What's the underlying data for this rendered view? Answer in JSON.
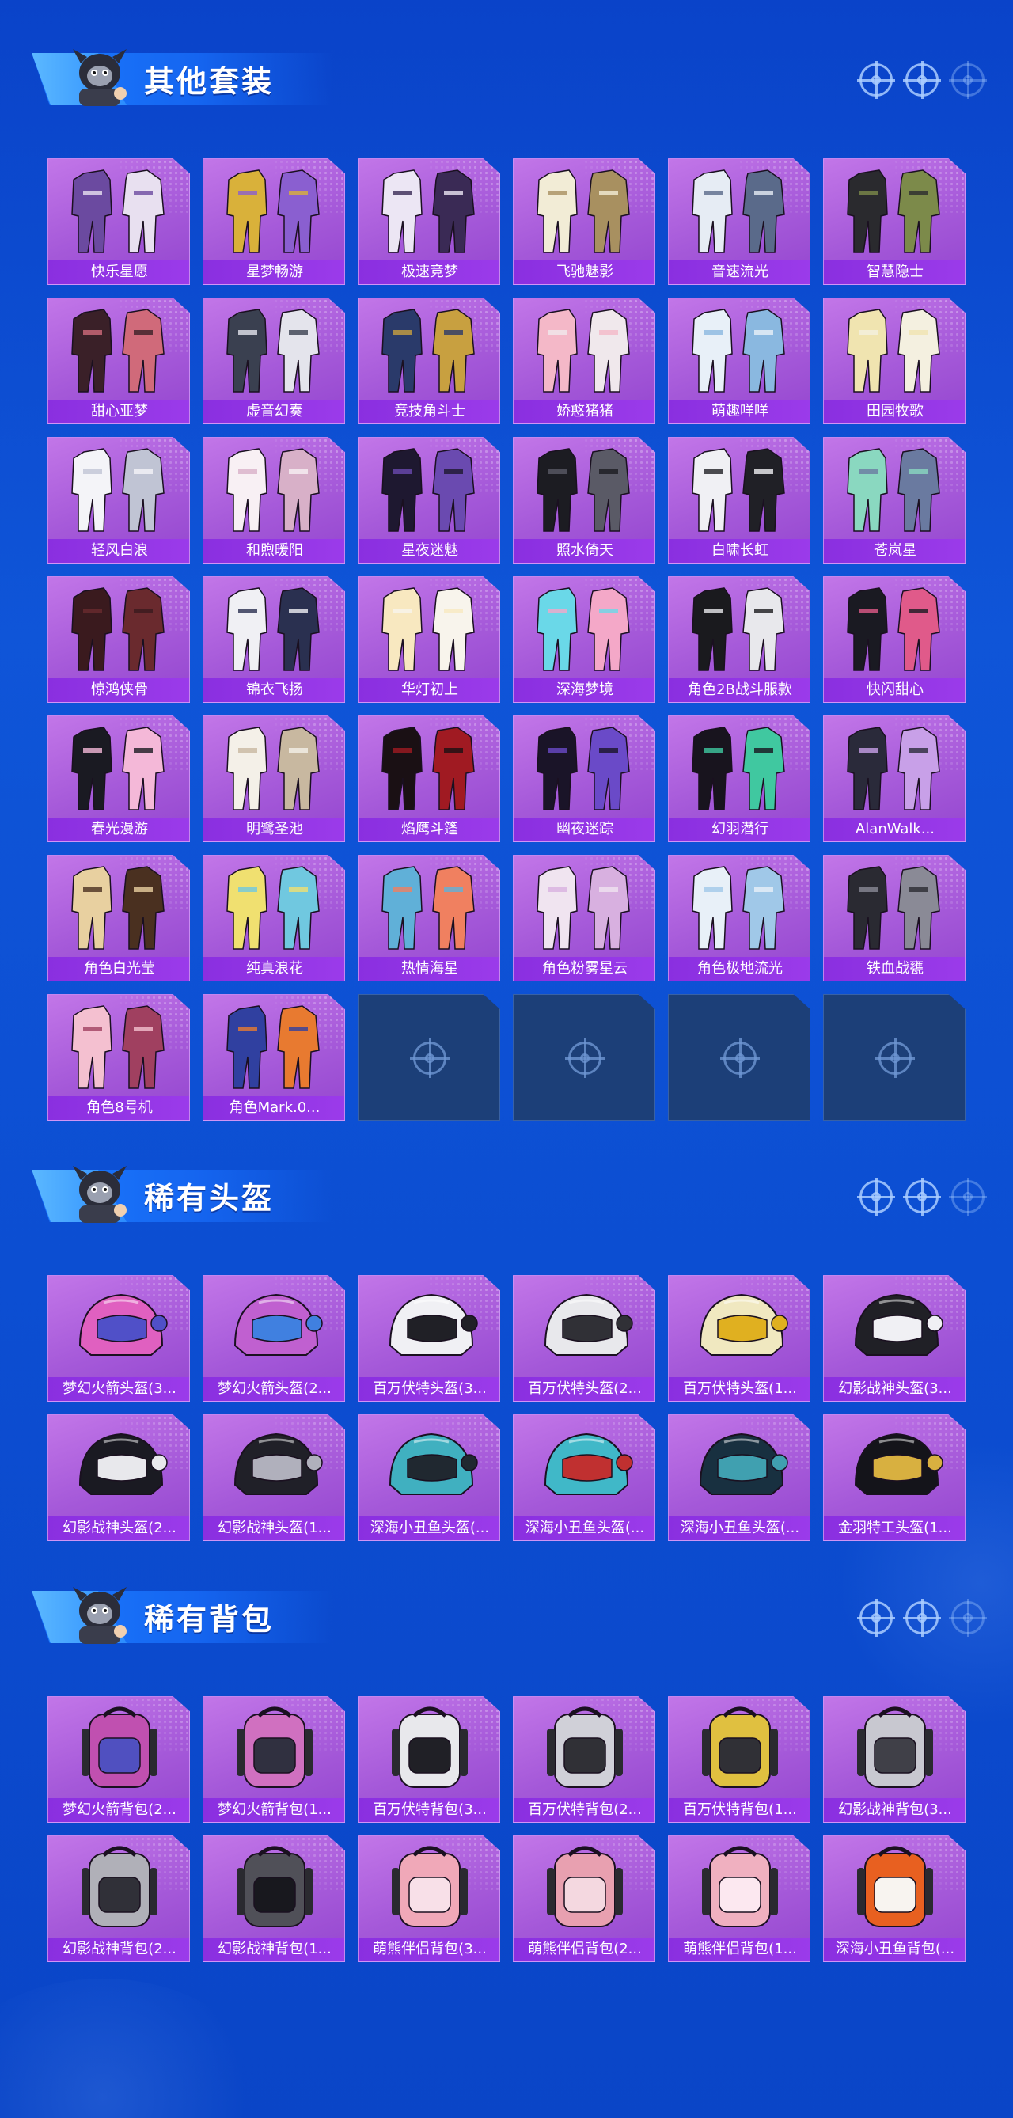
{
  "sections": [
    {
      "title": "其他套装",
      "item_type": "outfit",
      "items": [
        {
          "label": "快乐星愿",
          "c1": "#6b4aa0",
          "c2": "#e8e0f0"
        },
        {
          "label": "星梦畅游",
          "c1": "#d9b13a",
          "c2": "#8a5fd0"
        },
        {
          "label": "极速竞梦",
          "c1": "#ece6f4",
          "c2": "#3a2a55"
        },
        {
          "label": "飞驰魅影",
          "c1": "#f2ecd6",
          "c2": "#a89060"
        },
        {
          "label": "音速流光",
          "c1": "#e6ecf4",
          "c2": "#5a6a8a"
        },
        {
          "label": "智慧隐士",
          "c1": "#2a2a2e",
          "c2": "#7c8a4a"
        },
        {
          "label": "甜心亚梦",
          "c1": "#3a2028",
          "c2": "#d06a7a"
        },
        {
          "label": "虚音幻奏",
          "c1": "#3a4050",
          "c2": "#e4e4ec"
        },
        {
          "label": "竞技角斗士",
          "c1": "#2a3a6a",
          "c2": "#c8a040"
        },
        {
          "label": "娇憨猪猪",
          "c1": "#f4b8c8",
          "c2": "#f0e8ec"
        },
        {
          "label": "萌趣咩咩",
          "c1": "#e8f0f8",
          "c2": "#8ab8e0"
        },
        {
          "label": "田园牧歌",
          "c1": "#f0e4b0",
          "c2": "#f4f0e0"
        },
        {
          "label": "轻风白浪",
          "c1": "#f4f4f8",
          "c2": "#c0c4d4"
        },
        {
          "label": "和煦暖阳",
          "c1": "#f8f0f4",
          "c2": "#d8b0c8"
        },
        {
          "label": "星夜迷魅",
          "c1": "#1e1830",
          "c2": "#6a4ab0"
        },
        {
          "label": "照水倚天",
          "c1": "#1c1c22",
          "c2": "#5a5a66"
        },
        {
          "label": "白啸长虹",
          "c1": "#f0f0f4",
          "c2": "#202026"
        },
        {
          "label": "苍岚星",
          "c1": "#8ad8c0",
          "c2": "#6a7aa0"
        },
        {
          "label": "惊鸿侠骨",
          "c1": "#3a1a1e",
          "c2": "#6a2a2e"
        },
        {
          "label": "锦衣飞扬",
          "c1": "#f0f0f4",
          "c2": "#2a3050"
        },
        {
          "label": "华灯初上",
          "c1": "#f8e8c0",
          "c2": "#f8f4ec"
        },
        {
          "label": "深海梦境",
          "c1": "#6ad8e8",
          "c2": "#f4a8c8"
        },
        {
          "label": "角色2B战斗服款",
          "c1": "#1a1a1e",
          "c2": "#e8e8ec"
        },
        {
          "label": "快闪甜心",
          "c1": "#1a1a22",
          "c2": "#e05a8a"
        },
        {
          "label": "春光漫游",
          "c1": "#1a1a22",
          "c2": "#f4b8d8"
        },
        {
          "label": "明鹭圣池",
          "c1": "#f4f0e8",
          "c2": "#c8b8a0"
        },
        {
          "label": "焰鹰斗篷",
          "c1": "#1a1014",
          "c2": "#a01a22"
        },
        {
          "label": "幽夜迷踪",
          "c1": "#1a1428",
          "c2": "#6a4ac8"
        },
        {
          "label": "幻羽潜行",
          "c1": "#18141e",
          "c2": "#40c8a0"
        },
        {
          "label": "AlanWalk...",
          "c1": "#2a2a3a",
          "c2": "#c8a0e8"
        },
        {
          "label": "角色白光莹",
          "c1": "#e8d0a0",
          "c2": "#4a3020"
        },
        {
          "label": "纯真浪花",
          "c1": "#f0e070",
          "c2": "#70c8e0"
        },
        {
          "label": "热情海星",
          "c1": "#60b0d8",
          "c2": "#f08060"
        },
        {
          "label": "角色粉雾星云",
          "c1": "#f0e4f0",
          "c2": "#d8b0e0"
        },
        {
          "label": "角色极地流光",
          "c1": "#e8f0f8",
          "c2": "#a0c8e8"
        },
        {
          "label": "铁血战甕",
          "c1": "#2a2a32",
          "c2": "#8a8a96"
        },
        {
          "label": "角色8号机",
          "c1": "#f4c0d0",
          "c2": "#a04060"
        },
        {
          "label": "角色Mark.0...",
          "c1": "#3040a0",
          "c2": "#e87a30"
        },
        {
          "label": "",
          "empty": true
        },
        {
          "label": "",
          "empty": true
        },
        {
          "label": "",
          "empty": true
        },
        {
          "label": "",
          "empty": true
        }
      ]
    },
    {
      "title": "稀有头盔",
      "item_type": "helmet",
      "items": [
        {
          "label": "梦幻火箭头盔(3...",
          "c1": "#e060c0",
          "c2": "#5050c8"
        },
        {
          "label": "梦幻火箭头盔(2...",
          "c1": "#c060d0",
          "c2": "#4080e0"
        },
        {
          "label": "百万伏特头盔(3...",
          "c1": "#f0f0f4",
          "c2": "#202026"
        },
        {
          "label": "百万伏特头盔(2...",
          "c1": "#e8e8ec",
          "c2": "#303036"
        },
        {
          "label": "百万伏特头盔(1...",
          "c1": "#f0e8c0",
          "c2": "#e0b020"
        },
        {
          "label": "幻影战神头盔(3...",
          "c1": "#202026",
          "c2": "#f0f0f4"
        },
        {
          "label": "幻影战神头盔(2...",
          "c1": "#1a1a22",
          "c2": "#e8e8ec"
        },
        {
          "label": "幻影战神头盔(1...",
          "c1": "#202028",
          "c2": "#b0b0bc"
        },
        {
          "label": "深海小丑鱼头盔(...",
          "c1": "#40b0c0",
          "c2": "#202830"
        },
        {
          "label": "深海小丑鱼头盔(...",
          "c1": "#40b8c8",
          "c2": "#c03030"
        },
        {
          "label": "深海小丑鱼头盔(...",
          "c1": "#183040",
          "c2": "#40a0b0"
        },
        {
          "label": "金羽特工头盔(1...",
          "c1": "#14141a",
          "c2": "#d8b040"
        }
      ]
    },
    {
      "title": "稀有背包",
      "item_type": "backpack",
      "items": [
        {
          "label": "梦幻火箭背包(2...",
          "c1": "#c050b0",
          "c2": "#5050c0"
        },
        {
          "label": "梦幻火箭背包(1...",
          "c1": "#d070c0",
          "c2": "#303040"
        },
        {
          "label": "百万伏特背包(3...",
          "c1": "#e8e8ec",
          "c2": "#202026"
        },
        {
          "label": "百万伏特背包(2...",
          "c1": "#d0d0d8",
          "c2": "#303036"
        },
        {
          "label": "百万伏特背包(1...",
          "c1": "#e0c040",
          "c2": "#303036"
        },
        {
          "label": "幻影战神背包(3...",
          "c1": "#c8c8d0",
          "c2": "#404048"
        },
        {
          "label": "幻影战神背包(2...",
          "c1": "#b0b0b8",
          "c2": "#303038"
        },
        {
          "label": "幻影战神背包(1...",
          "c1": "#505058",
          "c2": "#18181e"
        },
        {
          "label": "萌熊伴侣背包(3...",
          "c1": "#f0a8b8",
          "c2": "#f8e0e8"
        },
        {
          "label": "萌熊伴侣背包(2...",
          "c1": "#e8a0b0",
          "c2": "#f4d8e0"
        },
        {
          "label": "萌熊伴侣背包(1...",
          "c1": "#f0b0c0",
          "c2": "#fce8f0"
        },
        {
          "label": "深海小丑鱼背包(...",
          "c1": "#e86020",
          "c2": "#f8f4f0"
        }
      ]
    }
  ]
}
